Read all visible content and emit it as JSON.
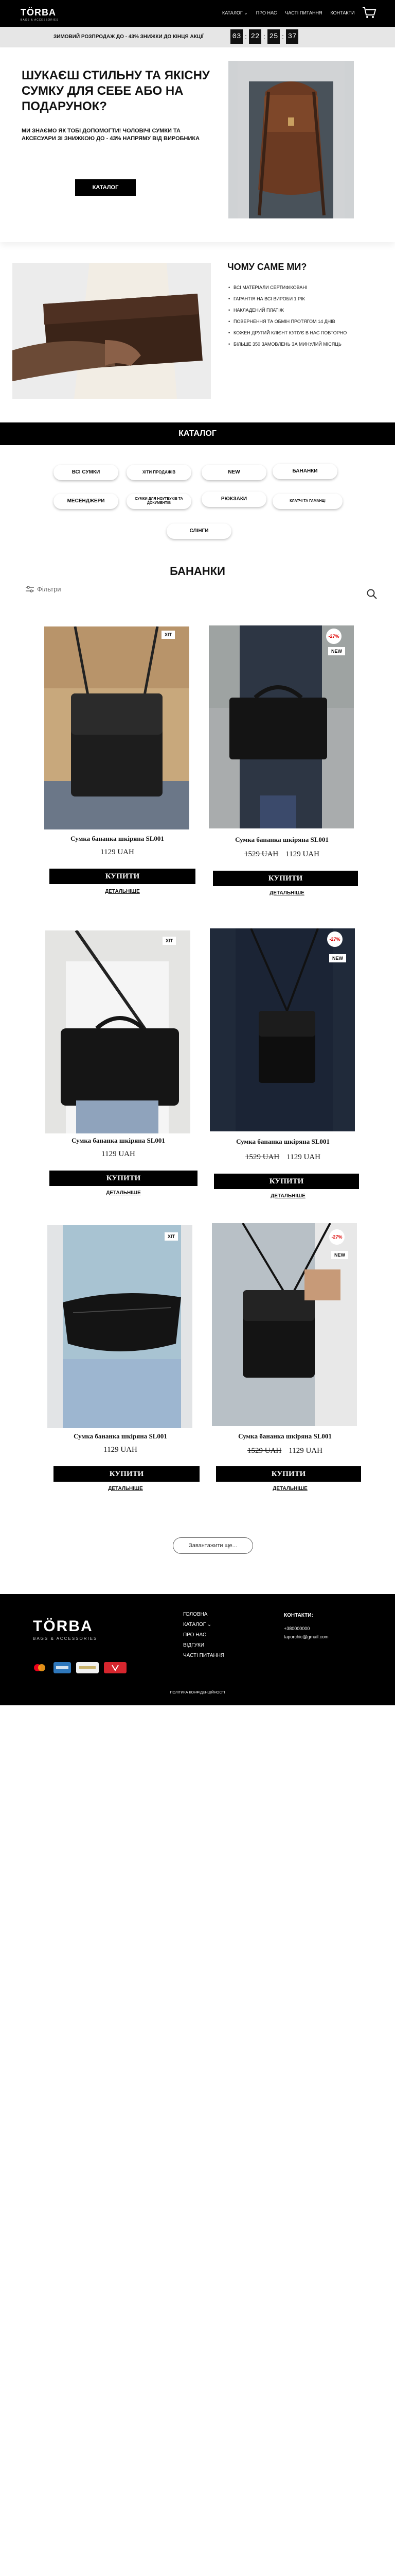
{
  "header": {
    "logo": "TÖRBA",
    "logo_sub": "BAGS & ACCESSORIES",
    "nav": [
      "КАТАЛОГ ⌄",
      "ПРО НАС",
      "ЧАСТІ ПИТАННЯ",
      "КОНТАКТИ"
    ],
    "cart_icon": "cart-icon"
  },
  "promo": {
    "text": "ЗИМОВИЙ РОЗПРОДАЖ ДО - 43% ЗНИЖКИ ДО КІНЦЯ АКЦІЇ",
    "timer": [
      "03",
      "22",
      "25",
      "37"
    ]
  },
  "hero": {
    "title": "ШУКАЄШ СТИЛЬНУ ТА ЯКІСНУ СУМКУ ДЛЯ СЕБЕ АБО НА ПОДАРУНОК?",
    "subtitle": "МИ ЗНАЄМО ЯК ТОБІ ДОПОМОГТИ! ЧОЛОВІЧІ СУМКИ ТА АКСЕСУАРИ ЗІ ЗНИЖКОЮ ДО - 43% НАПРЯМУ ВІД ВИРОБНИКА",
    "button": "КАТАЛОГ"
  },
  "why": {
    "title": "ЧОМУ САМЕ МИ?",
    "items": [
      "ВСІ МАТЕРІАЛИ СЕРТИФІКОВАНІ",
      "ГАРАНТІЯ НА ВСІ ВИРОБИ 1 РІК",
      "НАКЛАДЕНИЙ ПЛАТІЖ",
      "ПОВЕРНЕННЯ ТА ОБМІН ПРОТЯГОМ 14 ДНІВ",
      "КОЖЕН ДРУГИЙ КЛІЄНТ КУПУЄ В НАС ПОВТОРНО",
      "БІЛЬШЕ 350 ЗАМОВЛЕНЬ ЗА МИНУЛИЙ МІСЯЦЬ"
    ]
  },
  "catalog": {
    "title": "КАТАЛОГ",
    "categories": [
      "ВСІ СУМКИ",
      "ХІТИ ПРОДАЖІВ",
      "NEW",
      "БАНАНКИ",
      "МЕСЕНДЖЕРИ",
      "СУМКИ ДЛЯ НОУТБУКІВ ТА ДОКУМЕНТІВ",
      "РЮКЗАКИ",
      "КЛАТЧІ ТА ГАМАНЦІ",
      "СЛІНГИ"
    ]
  },
  "listing": {
    "title": "БАНАНКИ",
    "filter": "Фільтри",
    "load_more": "Завантажити ще...",
    "buy_label": "КУПИТИ",
    "details_label": "ДЕТАЛЬНІШЕ",
    "products": [
      {
        "name": "Сумка бананка шкіряна SL001",
        "price": "1129 UAH",
        "old_price": "",
        "badge": "ХІТ",
        "sale": "",
        "new": ""
      },
      {
        "name": "Сумка бананка шкіряна SL001",
        "price": "1129 UAH",
        "old_price": "1529 UAH",
        "badge": "",
        "sale": "-27%",
        "new": "NEW"
      },
      {
        "name": "Сумка бананка шкіряна SL001",
        "price": "1129 UAH",
        "old_price": "",
        "badge": "ХІТ",
        "sale": "",
        "new": ""
      },
      {
        "name": "Сумка бананка шкіряна SL001",
        "price": "1129 UAH",
        "old_price": "1529 UAH",
        "badge": "",
        "sale": "-27%",
        "new": "NEW"
      },
      {
        "name": "Сумка бананка шкіряна SL001",
        "price": "1129 UAH",
        "old_price": "",
        "badge": "ХІТ",
        "sale": "",
        "new": ""
      },
      {
        "name": "Сумка бананка шкіряна SL001",
        "price": "1129 UAH",
        "old_price": "1529 UAH",
        "badge": "",
        "sale": "-27%",
        "new": "NEW"
      }
    ]
  },
  "footer": {
    "logo": "TÖRBA",
    "logo_sub": "BAGS & ACCESSORIES",
    "links": [
      "ГОЛОВНА",
      "КАТАЛОГ ⌄",
      "ПРО НАС",
      "ВІДГУКИ",
      "ЧАСТІ ПИТАННЯ"
    ],
    "contacts_title": "КОНТАКТИ:",
    "phone": "+380000000",
    "email": "taporchic@gmail.com",
    "policy": "ПОЛІТИКА КОНФІДЕНЦІЙНОСТІ",
    "payments": [
      "mastercard-icon",
      "amex-icon",
      "bank-card-icon",
      "privat-icon"
    ]
  },
  "colors": {
    "accent": "#000000",
    "sale": "#dd0000",
    "promo_bg": "#e6e6e6"
  }
}
